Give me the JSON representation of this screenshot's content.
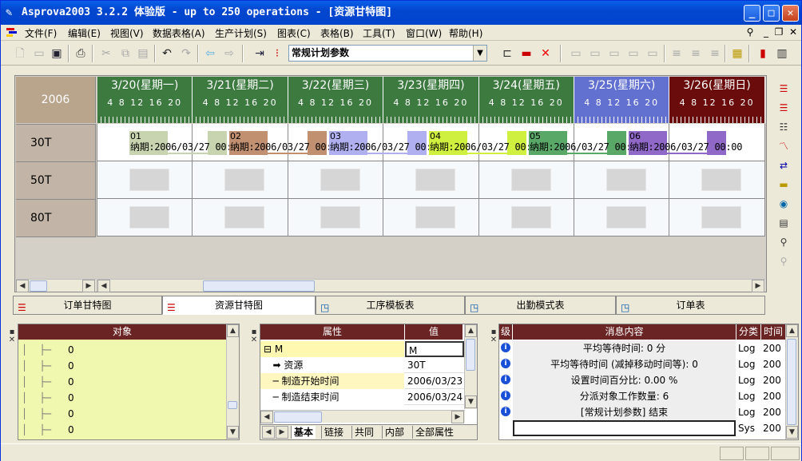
{
  "window": {
    "title": "Asprova2003 3.2.2 体验版  - up to 250 operations - [资源甘特图]"
  },
  "menu": [
    "文件(F)",
    "编辑(E)",
    "视图(V)",
    "数据表格(A)",
    "生产计划(S)",
    "图表(C)",
    "表格(B)",
    "工具(T)",
    "窗口(W)",
    "帮助(H)"
  ],
  "toolbar": {
    "combo_value": "常规计划参数"
  },
  "gantt": {
    "year": "2006",
    "days": [
      {
        "label": "3/20(星期一)",
        "color": "#3c7a40"
      },
      {
        "label": "3/21(星期二)",
        "color": "#3c7a40"
      },
      {
        "label": "3/22(星期三)",
        "color": "#3c7a40"
      },
      {
        "label": "3/23(星期四)",
        "color": "#3c7a40"
      },
      {
        "label": "3/24(星期五)",
        "color": "#3c7a40"
      },
      {
        "label": "3/25(星期六)",
        "color": "#6270d0"
      },
      {
        "label": "3/26(星期日)",
        "color": "#6a0c0c"
      }
    ],
    "hours": "4 8 12 16 20",
    "resources": [
      "30T",
      "50T",
      "80T"
    ],
    "operations": [
      {
        "num": "01",
        "label": "纳期:2006/03/27 00:00",
        "color": "#c8d4b0"
      },
      {
        "num": "02",
        "label": "纳期:2006/03/27 00:00",
        "color": "#c09070"
      },
      {
        "num": "03",
        "label": "纳期:2006/03/27 00:00",
        "color": "#b0b0f0"
      },
      {
        "num": "04",
        "label": "纳期:2006/03/27 00:00",
        "color": "#d0f040"
      },
      {
        "num": "05",
        "label": "纳期:2006/03/27 00:00",
        "color": "#5aa868"
      },
      {
        "num": "06",
        "label": "纳期:2006/03/27 00:00",
        "color": "#9068c8"
      }
    ]
  },
  "tabs": [
    "订单甘特图",
    "资源甘特图",
    "工序模板表",
    "出勤模式表",
    "订单表"
  ],
  "object_panel": {
    "header": "对象",
    "rows": [
      "0",
      "0",
      "0",
      "0",
      "0",
      "0"
    ]
  },
  "property_panel": {
    "headers": [
      "属性",
      "值"
    ],
    "rows": [
      {
        "name": "M",
        "value": "M"
      },
      {
        "name": "资源",
        "value": "30T"
      },
      {
        "name": "制造开始时间",
        "value": "2006/03/23"
      },
      {
        "name": "制造结束时间",
        "value": "2006/03/24"
      }
    ],
    "tabs": [
      "基本",
      "链接",
      "共同",
      "内部",
      "全部属性"
    ]
  },
  "message_panel": {
    "headers": [
      "级",
      "消息内容",
      "分类",
      "时间"
    ],
    "rows": [
      {
        "text": "平均等待时间: 0 分",
        "cat": "Log",
        "time": "200"
      },
      {
        "text": "平均等待时间 (减掉移动时间等): 0",
        "cat": "Log",
        "time": "200"
      },
      {
        "text": "设置时间百分比: 0.00 %",
        "cat": "Log",
        "time": "200"
      },
      {
        "text": "分派对象工作数量: 6",
        "cat": "Log",
        "time": "200"
      },
      {
        "text": "[常规计划参数] 结束",
        "cat": "Log",
        "time": "200"
      },
      {
        "text": "",
        "cat": "Sys",
        "time": "200"
      }
    ]
  }
}
